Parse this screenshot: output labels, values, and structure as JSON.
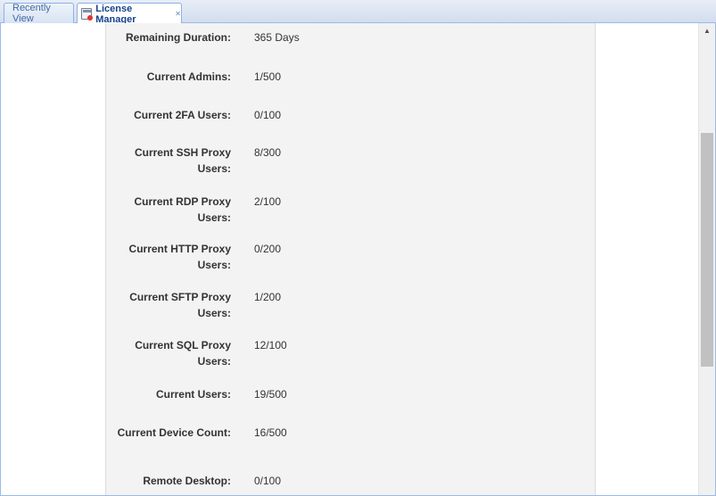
{
  "tabs": [
    {
      "label": "Recently View",
      "active": false
    },
    {
      "label": "License Manager",
      "active": true
    }
  ],
  "icons": {
    "tab_icon": "license-manager-icon",
    "close": "close-icon",
    "scroll_up": "arrow-up-icon"
  },
  "colors": {
    "tab_active_text": "#15428b",
    "tab_border": "#8db2e3",
    "panel_bg": "#f3f3f3"
  },
  "license": [
    {
      "label": "Remaining Duration:",
      "value": "365 Days"
    },
    {
      "label": "Current Admins:",
      "value": "1/500"
    },
    {
      "label": "Current 2FA Users:",
      "value": "0/100"
    },
    {
      "label": "Current SSH Proxy Users:",
      "value": "8/300"
    },
    {
      "label": "Current RDP Proxy Users:",
      "value": "2/100"
    },
    {
      "label": "Current HTTP Proxy Users:",
      "value": "0/200"
    },
    {
      "label": "Current SFTP Proxy Users:",
      "value": "1/200"
    },
    {
      "label": "Current SQL Proxy Users:",
      "value": "12/100"
    },
    {
      "label": "Current Users:",
      "value": "19/500"
    },
    {
      "label": "Current Device Count:",
      "value": "16/500"
    },
    {
      "label": "Remote Desktop:",
      "value": "0/100"
    }
  ]
}
